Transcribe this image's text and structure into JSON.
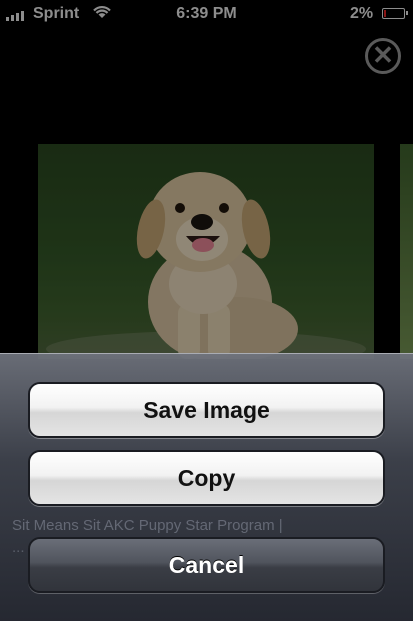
{
  "status_bar": {
    "carrier": "Sprint",
    "time": "6:39 PM",
    "battery_percent": "2%",
    "battery_level": 0.02,
    "icons": [
      "signal-bars-icon",
      "wifi-icon",
      "battery-icon"
    ]
  },
  "close_button": {
    "glyph": "✕",
    "icon": "close-circle-icon"
  },
  "background_caption": {
    "line1": "Sit Means Sit AKC Puppy Star Program |",
    "line2": "..."
  },
  "action_sheet": {
    "save_label": "Save Image",
    "copy_label": "Copy",
    "cancel_label": "Cancel"
  },
  "colors": {
    "battery_low": "#d42020",
    "cancel_button": "#3a3d45",
    "light_button": "#f2f2f2"
  }
}
